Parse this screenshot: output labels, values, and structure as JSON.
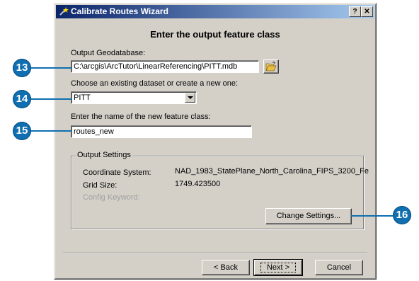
{
  "window": {
    "title": "Calibrate Routes Wizard",
    "help_label": "?",
    "close_label": "✕"
  },
  "heading": "Enter the output feature class",
  "geodatabase": {
    "label": "Output Geodatabase:",
    "value": "C:\\arcgis\\ArcTutor\\LinearReferencing\\PITT.mdb"
  },
  "dataset": {
    "label": "Choose an existing dataset or create a new one:",
    "value": "PITT"
  },
  "feature_class": {
    "label": "Enter the name of the new feature class:",
    "value": "routes_new"
  },
  "output_settings": {
    "title": "Output Settings",
    "coord_label": "Coordinate System:",
    "coord_value": "NAD_1983_StatePlane_North_Carolina_FIPS_3200_Fe",
    "grid_label": "Grid Size:",
    "grid_value": "1749.423500",
    "config_label": "Config Keyword:",
    "change_button": "Change Settings..."
  },
  "footer": {
    "back": "< Back",
    "next": "Next >",
    "cancel": "Cancel"
  },
  "callouts": [
    "13",
    "14",
    "15",
    "16"
  ],
  "colors": {
    "callout": "#0f6fb0",
    "titlebar_start": "#0a246a",
    "titlebar_end": "#a6caf0",
    "dialog_face": "#d4d0c8"
  }
}
